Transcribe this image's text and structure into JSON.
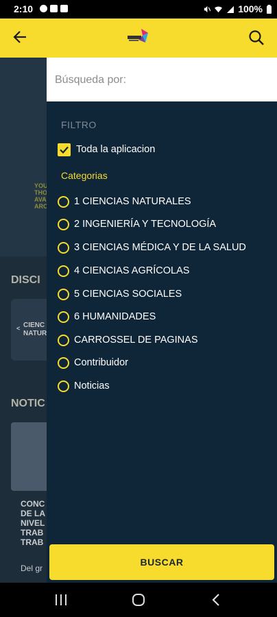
{
  "status_bar": {
    "time": "2:10",
    "battery": "100%"
  },
  "app_bar": {
    "back_icon": "arrow-left-icon",
    "logo": "app-logo",
    "search_icon": "magnifier-icon"
  },
  "background": {
    "section_disc": "DISCI",
    "section_noti": "NOTIC",
    "hero_lines": [
      "YOU",
      "THO",
      "AVA",
      "ARC"
    ],
    "card_lines": [
      "CIENC",
      "NATUR"
    ],
    "article_lines": [
      "CONC",
      "DE LA",
      "NIVEL",
      "TRAB",
      "TRAB"
    ],
    "article_snippet": "Del gr"
  },
  "drawer": {
    "search": {
      "placeholder": "Búsqueda por:",
      "value": ""
    },
    "filter_heading": "FILTRO",
    "all_app": {
      "label": "Toda la aplicacion",
      "checked": true
    },
    "categories_heading": "Categorias",
    "categories": [
      "1 CIENCIAS NATURALES",
      "2 INGENIERÍA Y TECNOLOGÍA",
      "3 CIENCIAS MÉDICA Y DE LA SALUD",
      "4 CIENCIAS AGRÍCOLAS",
      "5 CIENCIAS SOCIALES",
      "6 HUMANIDADES",
      "CARROSSEL DE PAGINAS",
      "Contribuidor",
      "Noticias"
    ],
    "search_button": "BUSCAR"
  },
  "colors": {
    "accent": "#f7dc2e",
    "drawer_bg": "#0f2538",
    "status_bg": "#000000"
  }
}
